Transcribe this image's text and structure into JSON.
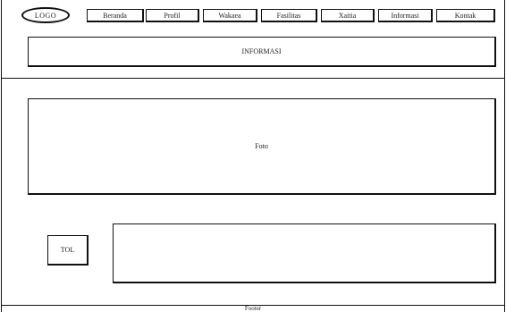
{
  "header": {
    "logo_label": "LOGO",
    "nav_items": [
      "Beranda",
      "Profil",
      "Wakaea",
      "Fasilitas",
      "Xaitia",
      "Informasi",
      "Kontak"
    ]
  },
  "banner": {
    "label": "INFORMASI"
  },
  "main": {
    "photo_label": "Foto",
    "button_label": "TOL"
  },
  "footer": {
    "label": "Footer"
  }
}
